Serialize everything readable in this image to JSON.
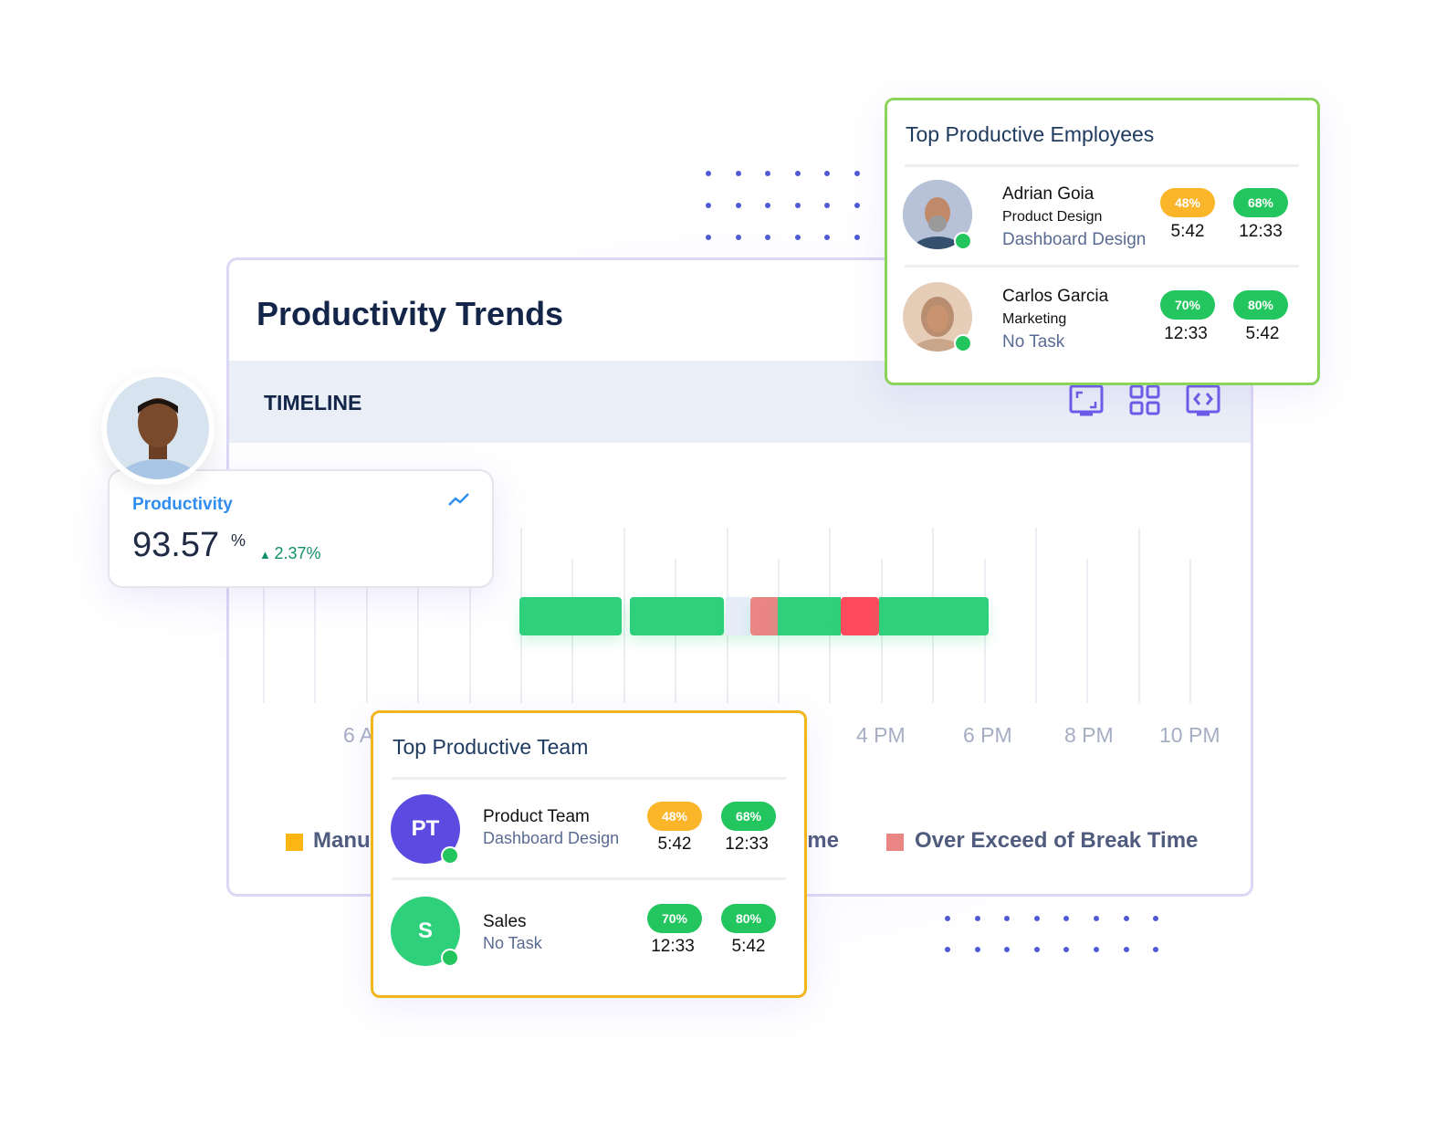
{
  "main": {
    "title": "Productivity Trends",
    "timeline_label": "TIMELINE",
    "icons": [
      "fullscreen-icon",
      "grid-view-icon",
      "embed-code-icon"
    ]
  },
  "chart_data": {
    "type": "timeline",
    "x_ticks": [
      "6 AM",
      "4 PM",
      "6 PM",
      "8 PM",
      "10 PM"
    ],
    "segments": [
      {
        "status": "productive",
        "color": "#2fd07b"
      },
      {
        "status": "productive",
        "color": "#2fd07b"
      },
      {
        "status": "idle",
        "color": "#e6edf8"
      },
      {
        "status": "over-exceed-break",
        "color": "#e98583"
      },
      {
        "status": "productive",
        "color": "#2fd07b"
      },
      {
        "status": "alert",
        "color": "#ff4a5e"
      },
      {
        "status": "productive",
        "color": "#2fd07b"
      }
    ],
    "legend": [
      {
        "label": "Manual Time",
        "color": "#fdb614"
      },
      {
        "label": "Break Time",
        "color": "#9aa3c0"
      },
      {
        "label": "Over Exceed of Break Time",
        "color": "#e98583"
      }
    ]
  },
  "productivity": {
    "label": "Productivity",
    "value": "93.57",
    "unit": "%",
    "change": "2.37%",
    "trend": "up"
  },
  "employees": {
    "title": "Top Productive Employees",
    "rows": [
      {
        "name": "Adrian Goia",
        "dept": "Product Design",
        "task": "Dashboard Design",
        "p1": "48%",
        "t1": "5:42",
        "p2": "68%",
        "t2": "12:33",
        "c1": "#fbb529",
        "c2": "#22c55e"
      },
      {
        "name": "Carlos Garcia",
        "dept": "Marketing",
        "task": "No Task",
        "p1": "70%",
        "t1": "12:33",
        "p2": "80%",
        "t2": "5:42",
        "c1": "#22c55e",
        "c2": "#22c55e"
      }
    ]
  },
  "team": {
    "title": "Top Productive Team",
    "rows": [
      {
        "initials": "PT",
        "name": "Product Team",
        "task": "Dashboard Design",
        "p1": "48%",
        "t1": "5:42",
        "p2": "68%",
        "t2": "12:33",
        "avatar_color": "#5b4be0"
      },
      {
        "initials": "S",
        "name": "Sales",
        "task": "No Task",
        "p1": "70%",
        "t1": "12:33",
        "p2": "80%",
        "t2": "5:42",
        "avatar_color": "#2fd07b"
      }
    ]
  }
}
